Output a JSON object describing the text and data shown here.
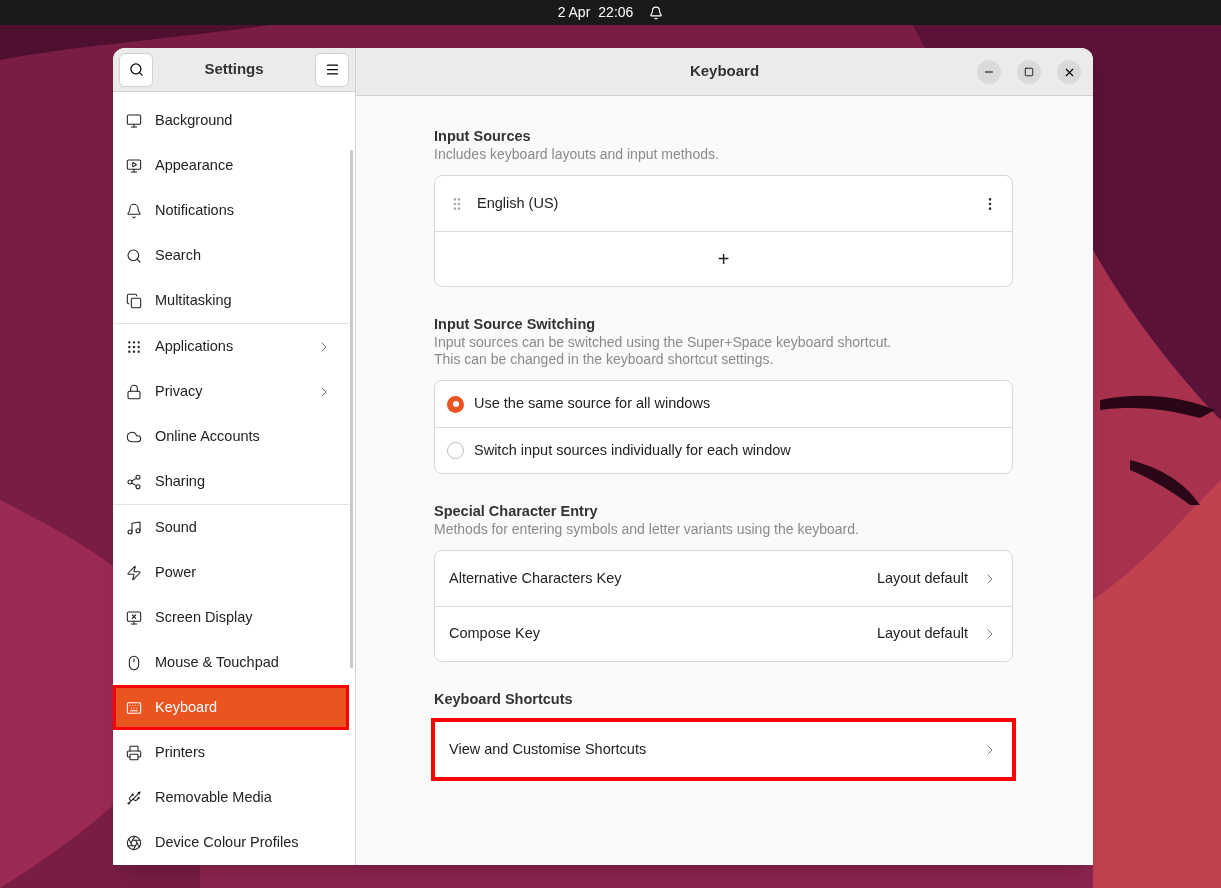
{
  "top_bar": {
    "date": "2 Apr",
    "time": "22:06"
  },
  "sidebar": {
    "title": "Settings",
    "groups": [
      [
        {
          "label": "Background",
          "selected": false,
          "highlighted": false,
          "has_arrow": false
        },
        {
          "label": "Appearance",
          "selected": false,
          "highlighted": false,
          "has_arrow": false
        },
        {
          "label": "Notifications",
          "selected": false,
          "highlighted": false,
          "has_arrow": false
        },
        {
          "label": "Search",
          "selected": false,
          "highlighted": false,
          "has_arrow": false
        },
        {
          "label": "Multitasking",
          "selected": false,
          "highlighted": false,
          "has_arrow": false
        }
      ],
      [
        {
          "label": "Applications",
          "selected": false,
          "highlighted": false,
          "has_arrow": true
        },
        {
          "label": "Privacy",
          "selected": false,
          "highlighted": false,
          "has_arrow": true
        },
        {
          "label": "Online Accounts",
          "selected": false,
          "highlighted": false,
          "has_arrow": false
        },
        {
          "label": "Sharing",
          "selected": false,
          "highlighted": false,
          "has_arrow": false
        }
      ],
      [
        {
          "label": "Sound",
          "selected": false,
          "highlighted": false,
          "has_arrow": false
        },
        {
          "label": "Power",
          "selected": false,
          "highlighted": false,
          "has_arrow": false
        },
        {
          "label": "Screen Display",
          "selected": false,
          "highlighted": false,
          "has_arrow": false
        },
        {
          "label": "Mouse & Touchpad",
          "selected": false,
          "highlighted": false,
          "has_arrow": false
        },
        {
          "label": "Keyboard",
          "selected": true,
          "highlighted": true,
          "has_arrow": false
        },
        {
          "label": "Printers",
          "selected": false,
          "highlighted": false,
          "has_arrow": false
        },
        {
          "label": "Removable Media",
          "selected": false,
          "highlighted": false,
          "has_arrow": false
        },
        {
          "label": "Device Colour Profiles",
          "selected": false,
          "highlighted": false,
          "has_arrow": false
        }
      ]
    ]
  },
  "window": {
    "title": "Keyboard"
  },
  "sections": [
    {
      "kind": "sources",
      "title": "Input Sources",
      "description": [
        "Includes keyboard layouts and input methods."
      ],
      "rows": [
        {
          "label": "English (US)"
        }
      ],
      "add_label": "+"
    },
    {
      "kind": "radios",
      "title": "Input Source Switching",
      "description": [
        "Input sources can be switched using the Super+Space keyboard shortcut.",
        "This can be changed in the keyboard shortcut settings."
      ],
      "rows": [
        {
          "label": "Use the same source for all windows",
          "selected": true
        },
        {
          "label": "Switch input sources individually for each window",
          "selected": false
        }
      ]
    },
    {
      "kind": "links",
      "title": "Special Character Entry",
      "description": [
        "Methods for entering symbols and letter variants using the keyboard."
      ],
      "rows": [
        {
          "label": "Alternative Characters Key",
          "value": "Layout default",
          "highlighted": false
        },
        {
          "label": "Compose Key",
          "value": "Layout default",
          "highlighted": false
        }
      ]
    },
    {
      "kind": "links",
      "title": "Keyboard Shortcuts",
      "rows": [
        {
          "label": "View and Customise Shortcuts",
          "highlighted": true
        }
      ]
    }
  ]
}
